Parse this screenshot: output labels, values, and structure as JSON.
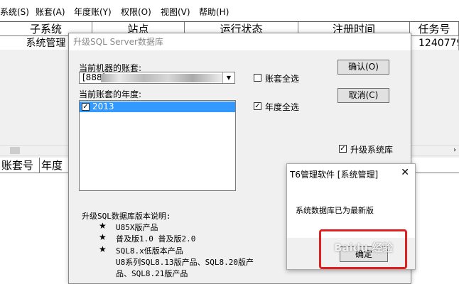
{
  "menubar": {
    "items": [
      "系统(S)",
      "账套(A)",
      "年度账(Y)",
      "权限(O)",
      "视图(V)",
      "帮助(H)"
    ]
  },
  "top_table": {
    "headers": [
      "子系统",
      "站点",
      "运行状态",
      "注册时间",
      "任务号"
    ],
    "row": [
      "系统管理",
      "",
      "",
      "",
      "1240779"
    ]
  },
  "bottom_table": {
    "headers": [
      "账套号",
      "年度"
    ]
  },
  "upgrade_dialog": {
    "title": "升级SQL Server数据库",
    "account_label": "当前机器的账套:",
    "account_value": "[888]",
    "year_label": "当前账套的年度:",
    "year_items": [
      {
        "label": "2013",
        "checked": true,
        "selected": true
      }
    ],
    "select_all_accounts": {
      "label": "账套全选",
      "checked": false
    },
    "select_all_years": {
      "label": "年度全选",
      "checked": true
    },
    "upgrade_system_db": {
      "label": "升级系统库",
      "checked": true
    },
    "confirm_label": "确认(O)",
    "cancel_label": "取消(C)",
    "desc_title": "升级SQL数据库版本说明:",
    "desc_items": [
      "U85X版产品",
      "普及版1.0 普及版2.0",
      "SQL8.x低版本产品"
    ],
    "desc_extra_lines": [
      "U8系列SQL8.13版产品、SQL8.20版产",
      "品、SQL8.21版产品"
    ],
    "bullet": "★"
  },
  "message_box": {
    "title": "T6管理软件 [系统管理]",
    "message": "系统数据库已为最新版",
    "ok_label": "确定",
    "close_glyph": "✕"
  },
  "watermark": "Baidu 经验",
  "colors": {
    "highlight": "#e02020",
    "selection": "#3399ff"
  }
}
